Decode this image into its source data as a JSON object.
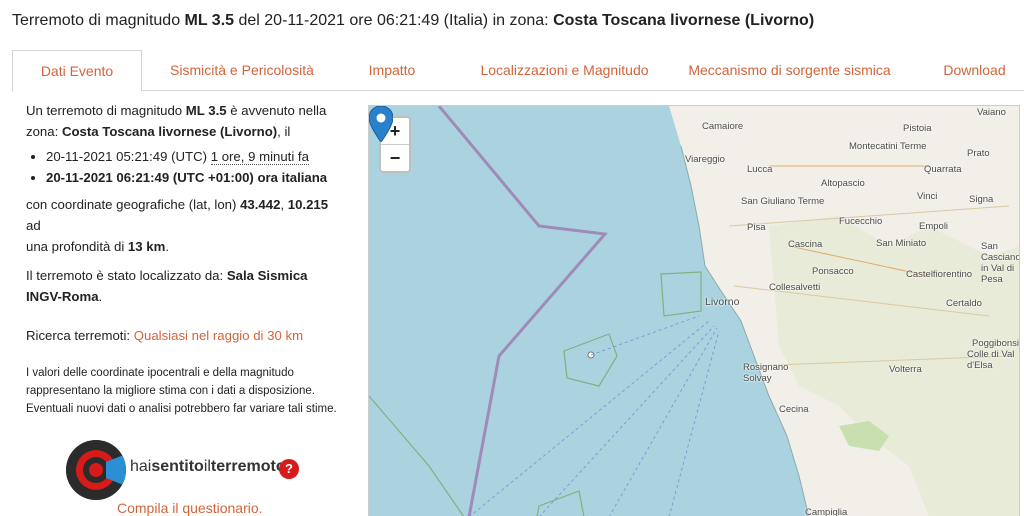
{
  "header": {
    "prefix": "Terremoto di magnitudo ",
    "magnitude": "ML 3.5",
    "mid": " del 20-11-2021 ore 06:21:49 (Italia) in zona: ",
    "zone": "Costa Toscana livornese (Livorno)"
  },
  "tabs": [
    {
      "label": "Dati Evento"
    },
    {
      "label": "Sismicità e Pericolosità"
    },
    {
      "label": "Impatto"
    },
    {
      "label": "Localizzazioni e Magnitudo"
    },
    {
      "label": "Meccanismo di sorgente sismica"
    },
    {
      "label": "Download"
    }
  ],
  "summary": {
    "intro_prefix": "Un terremoto di magnitudo ",
    "magnitude": "ML 3.5",
    "intro_suffix": " è avvenuto nella",
    "zone_prefix": "zona: ",
    "zone": "Costa Toscana livornese (Livorno)",
    "zone_suffix": ", il",
    "utc_time": "20-11-2021 05:21:49 (UTC) ",
    "ago": "1 ore, 9 minuti fa",
    "local_time": "20-11-2021 06:21:49 (UTC +01:00) ora italiana",
    "coords_prefix": "con coordinate geografiche (lat, lon) ",
    "lat": "43.442",
    "coords_sep": ", ",
    "lon": "10.215",
    "coords_suffix": " ad",
    "depth_prefix": "una profondità di ",
    "depth": "13 km",
    "depth_suffix": ".",
    "located_prefix": "Il terremoto è stato localizzato da: ",
    "located_by": "Sala Sismica INGV-Roma",
    "located_suffix": ".",
    "search_label": "Ricerca terremoti: ",
    "search_link": "Qualsiasi nel raggio di 30 km",
    "disclaimer_1": "I valori delle coordinate ipocentrali e della magnitudo",
    "disclaimer_2": "rappresentano la migliore stima con i dati a disposizione.",
    "disclaimer_3": "Eventuali nuovi dati o analisi potrebbero far variare tali stime."
  },
  "hst": {
    "text_a": "hai",
    "text_b": "sentito",
    "text_c": "il",
    "text_d": "terremoto",
    "help": "?",
    "link": "Compila il questionario."
  },
  "map": {
    "zoom_in": "+",
    "zoom_out": "−",
    "places": [
      "Camaiore",
      "Pistoia",
      "Viareggio",
      "Montecatini Terme",
      "Prato",
      "Lucca",
      "Quarrata",
      "Altopascio",
      "Vinci",
      "San Giuliano Terme",
      "Signa",
      "Fucecchio",
      "Empoli",
      "Pisa",
      "Cascina",
      "San Miniato",
      "San Casciano in Val di Pesa",
      "Ponsacco",
      "Castelfiorentino",
      "Collesalvetti",
      "Livorno",
      "Certaldo",
      "Poggibonsi",
      "Colle di Val d'Elsa",
      "Rosignano Solvay",
      "Volterra",
      "Cecina",
      "Vaiano",
      "Campiglia"
    ],
    "colors": {
      "sea": "#aad3df",
      "land": "#f2efe9",
      "green": "#c8e0b0",
      "boundary": "#a08ab8",
      "pin": "#2a81cb"
    }
  }
}
